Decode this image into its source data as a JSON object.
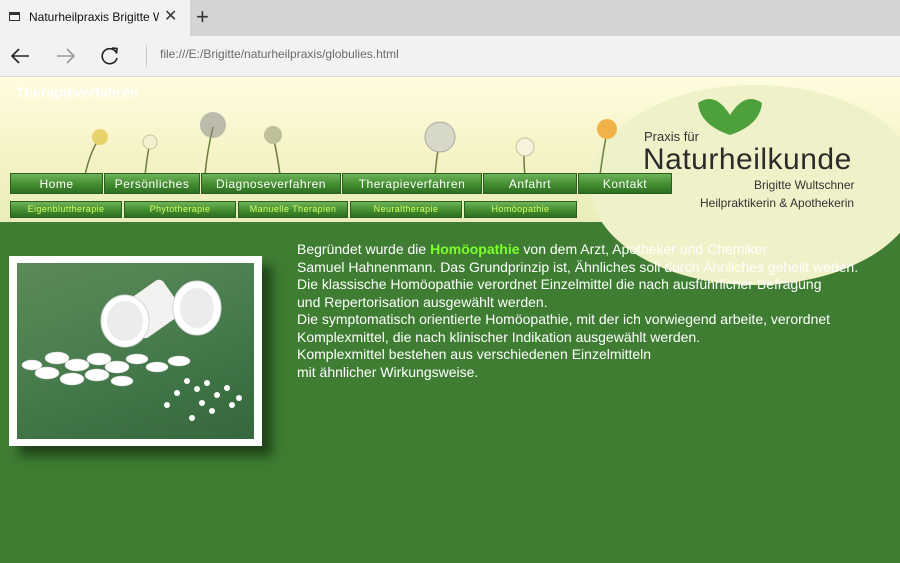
{
  "browser": {
    "tab_title": "Naturheilpraxis Brigitte W",
    "tab_close": "✕",
    "new_tab": "+",
    "address": "file:///E:/Brigitte/naturheilpraxis/globulies.html",
    "back_icon": "arrow-left-icon",
    "forward_icon": "arrow-right-icon",
    "refresh_icon": "refresh-icon"
  },
  "page": {
    "heading": "Therapieverfahren",
    "logo": {
      "praxis": "Praxis für",
      "main": "Naturheilkunde",
      "name": "Brigitte Wultschner",
      "sub": "Heilpraktikerin & Apothekerin"
    },
    "menu": [
      "Home",
      "Persönliches",
      "Diagnoseverfahren",
      "Therapieverfahren",
      "Anfahrt",
      "Kontakt"
    ],
    "submenu": [
      "Eigenbluttherapie",
      "Phytotherapie",
      "Manuelle Therapien",
      "Neuraltherapie",
      "Homöopathie"
    ],
    "content": {
      "line1_pre": "Begründet wurde die ",
      "line1_hl": "Homöopathie",
      "line1_post": " von dem Arzt, Apotheker und Chemiker",
      "lines": [
        "Samuel Hahnenmann. Das Grundprinzip ist, Ähnliches soll durch Ähnliches geheilt weden.",
        "Die klassische Homöopathie verordnet Einzelmittel die nach ausführlicher Befragung",
        "und Repertorisation ausgewählt werden.",
        "Die symptomatisch orientierte Homöopathie, mit der ich vorwiegend arbeite, verordnet",
        "Komplexmittel, die nach klinischer Indikation ausgewählt werden.",
        "Komplexmittel bestehen aus verschiedenen Einzelmitteln",
        "mit ähnlicher Wirkungsweise."
      ]
    },
    "colors": {
      "background": "#3f7d33",
      "highlight": "#7cff2e",
      "submenu_text": "#d6ff60"
    }
  }
}
